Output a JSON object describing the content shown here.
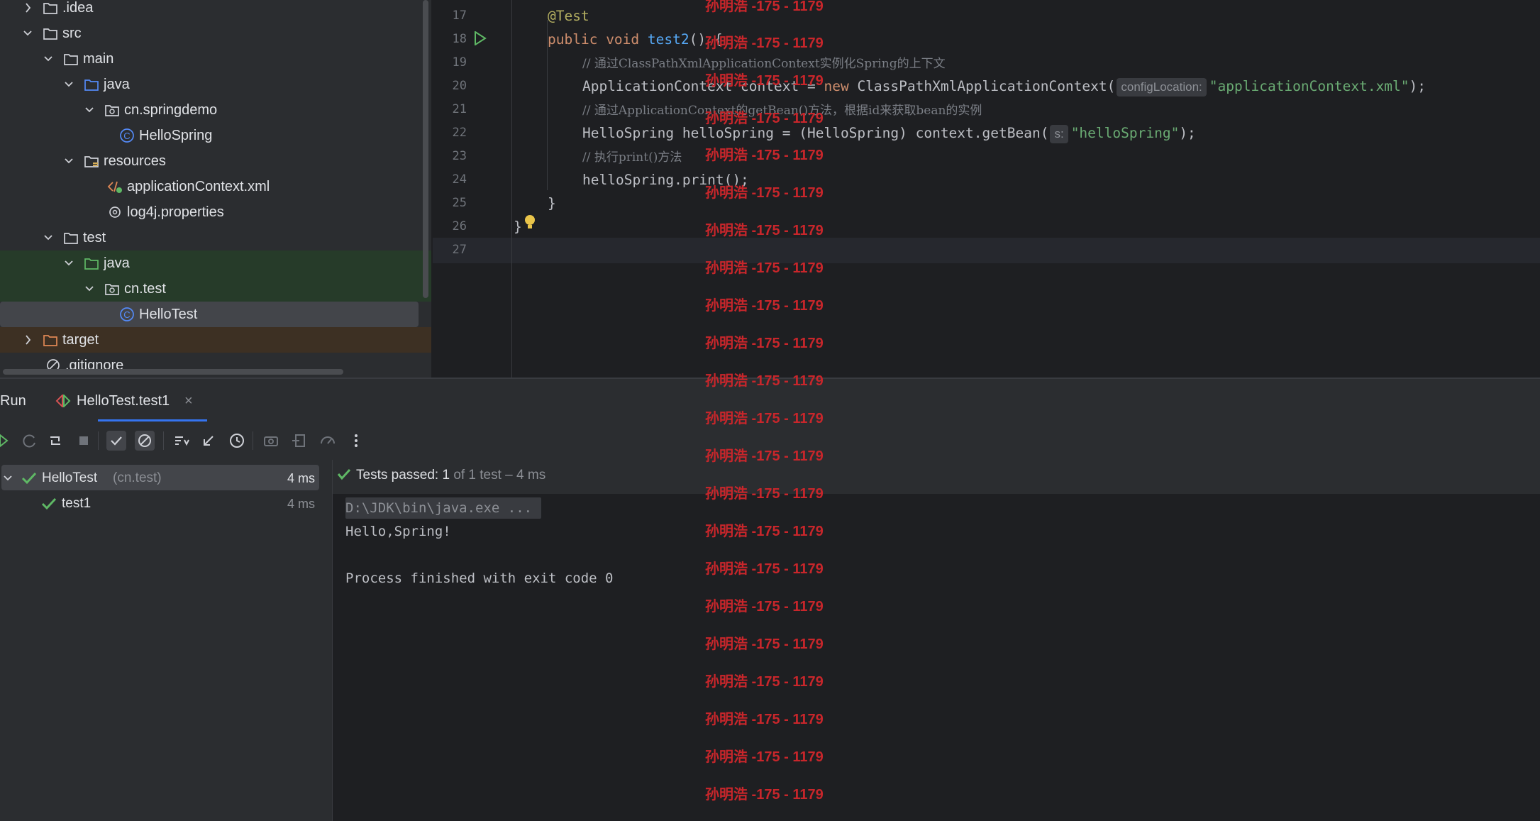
{
  "project_tree": {
    "items": [
      {
        "label": ".idea",
        "icon": "folder-icon",
        "chevron": "right"
      },
      {
        "label": "src",
        "icon": "folder-icon",
        "chevron": "down"
      },
      {
        "label": "main",
        "icon": "folder-icon",
        "chevron": "down"
      },
      {
        "label": "java",
        "icon": "source-folder-icon",
        "chevron": "down"
      },
      {
        "label": "cn.springdemo",
        "icon": "package-icon",
        "chevron": "down"
      },
      {
        "label": "HelloSpring",
        "icon": "class-icon",
        "chevron": ""
      },
      {
        "label": "resources",
        "icon": "resources-folder-icon",
        "chevron": "down"
      },
      {
        "label": "applicationContext.xml",
        "icon": "xml-file-icon",
        "chevron": ""
      },
      {
        "label": "log4j.properties",
        "icon": "properties-file-icon",
        "chevron": ""
      },
      {
        "label": "test",
        "icon": "folder-icon",
        "chevron": "down"
      },
      {
        "label": "java",
        "icon": "test-source-folder-icon",
        "chevron": "down"
      },
      {
        "label": "cn.test",
        "icon": "package-icon",
        "chevron": "down"
      },
      {
        "label": "HelloTest",
        "icon": "class-icon",
        "chevron": ""
      },
      {
        "label": "target",
        "icon": "excluded-folder-icon",
        "chevron": "right"
      },
      {
        "label": ".gitignore",
        "icon": "ignored-file-icon",
        "chevron": ""
      }
    ]
  },
  "editor": {
    "lines": [
      {
        "num": "17",
        "tokens": [
          {
            "t": "@Test",
            "c": "ann"
          }
        ]
      },
      {
        "num": "18",
        "tokens": [
          {
            "t": "public ",
            "c": "kw"
          },
          {
            "t": "void ",
            "c": "kw"
          },
          {
            "t": "test2",
            "c": "fn"
          },
          {
            "t": "() {",
            "c": ""
          }
        ]
      },
      {
        "num": "19",
        "tokens": [
          {
            "t": "// 通过ClassPathXmlApplicationContext实例化Spring的上下文",
            "c": "cmt"
          }
        ]
      },
      {
        "num": "20",
        "tokens": [
          {
            "t": "ApplicationContext context = ",
            "c": ""
          },
          {
            "t": "new ",
            "c": "kw"
          },
          {
            "t": "ClassPathXmlApplicationContext(",
            "c": ""
          },
          {
            "t": "configLocation:",
            "c": "hint"
          },
          {
            "t": "\"applicationContext.xml\"",
            "c": "str"
          },
          {
            "t": ");",
            "c": ""
          }
        ]
      },
      {
        "num": "21",
        "tokens": [
          {
            "t": "// 通过ApplicationContext的getBean()方法，根据id来获取bean的实例",
            "c": "cmt"
          }
        ]
      },
      {
        "num": "22",
        "tokens": [
          {
            "t": "HelloSpring helloSpring = (HelloSpring) context.getBean(",
            "c": ""
          },
          {
            "t": "s:",
            "c": "hint"
          },
          {
            "t": "\"helloSpring\"",
            "c": "str"
          },
          {
            "t": ");",
            "c": ""
          }
        ]
      },
      {
        "num": "23",
        "tokens": [
          {
            "t": "// 执行print()方法",
            "c": "cmt"
          }
        ]
      },
      {
        "num": "24",
        "tokens": [
          {
            "t": "helloSpring.print();",
            "c": ""
          }
        ]
      },
      {
        "num": "25",
        "tokens": [
          {
            "t": "}",
            "c": ""
          }
        ]
      },
      {
        "num": "26",
        "tokens": [
          {
            "t": "}",
            "c": ""
          }
        ]
      },
      {
        "num": "27",
        "tokens": []
      }
    ]
  },
  "run_panel": {
    "title": "Run",
    "tab_label": "HelloTest.test1",
    "toolbar_icons": [
      "rerun-icon",
      "rerun-failed-icon",
      "toggle-auto-test-icon",
      "stop-icon",
      "show-passed-icon",
      "show-ignored-icon",
      "sort-icon",
      "collapse-icon",
      "history-icon",
      "screenshot-icon",
      "import-icon",
      "export-icon",
      "more-icon"
    ],
    "tree": [
      {
        "name": "HelloTest",
        "pkg": "(cn.test)",
        "time": "4 ms"
      },
      {
        "name": "test1",
        "pkg": "",
        "time": "4 ms"
      }
    ],
    "status": {
      "label": "Tests passed: ",
      "count": "1",
      "rest": "of 1 test – 4 ms"
    },
    "console": [
      "D:\\JDK\\bin\\java.exe ...",
      "Hello,Spring!",
      "",
      "Process finished with exit code 0"
    ]
  },
  "watermark": "孙明浩 -175 - 1179",
  "colors": {
    "accent": "#4e9a4e",
    "watermark": "#c8262b",
    "keyword": "#cf8e6d",
    "string": "#6aab73",
    "method": "#56a8f5"
  }
}
